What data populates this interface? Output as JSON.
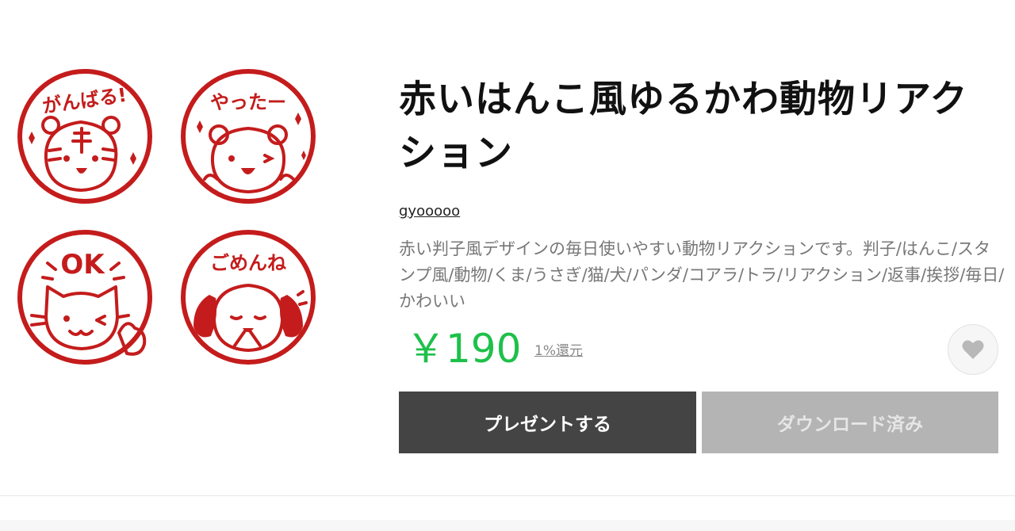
{
  "product": {
    "title": "赤いはんこ風ゆるかわ動物リアクション",
    "author": "gyooooo",
    "description": "赤い判子風デザインの毎日使いやすい動物リアクションです。判子/はんこ/スタンプ風/動物/くま/うさぎ/猫/犬/パンダ/コアラ/トラ/リアクション/返事/挨拶/毎日/かわいい",
    "price": "￥190",
    "reward": "1%還元"
  },
  "stamps": [
    {
      "label": "がんばる!",
      "animal": "tiger"
    },
    {
      "label": "やったー",
      "animal": "bear"
    },
    {
      "label": "OK",
      "animal": "cat"
    },
    {
      "label": "ごめんね",
      "animal": "dog"
    }
  ],
  "buttons": {
    "gift_label": "プレゼントする",
    "download_label": "ダウンロード済み"
  },
  "icons": {
    "favorite": "heart-icon"
  },
  "colors": {
    "stamp_red": "#c41c1c",
    "price_green": "#1ec04a",
    "gift_button": "#444444",
    "download_button": "#b4b4b4"
  }
}
